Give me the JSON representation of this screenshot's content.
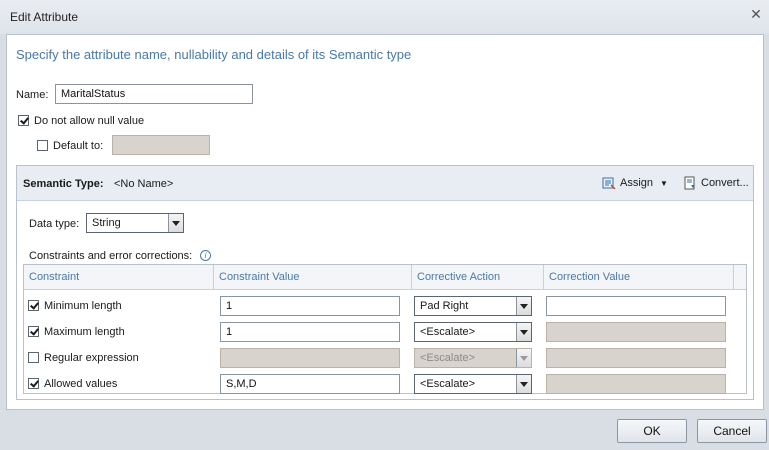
{
  "window": {
    "title": "Edit Attribute"
  },
  "heading": "Specify the attribute name, nullability and details of its Semantic type",
  "name": {
    "label": "Name:",
    "value": "MaritalStatus"
  },
  "null_option": {
    "label": "Do not allow null value",
    "checked": true
  },
  "default_option": {
    "label": "Default to:",
    "checked": false,
    "value": ""
  },
  "semantic": {
    "label": "Semantic Type:",
    "value": "<No Name>",
    "assign_label": "Assign",
    "convert_label": "Convert...",
    "data_type_label": "Data type:",
    "data_type_value": "String",
    "constraints_label": "Constraints and error corrections:"
  },
  "grid": {
    "headers": [
      "Constraint",
      "Constraint Value",
      "Corrective Action",
      "Correction Value"
    ],
    "rows": [
      {
        "checked": true,
        "constraint": "Minimum length",
        "value": "1",
        "action": "Pad Right",
        "action_enabled": true,
        "correction": "",
        "correction_enabled": true
      },
      {
        "checked": true,
        "constraint": "Maximum length",
        "value": "1",
        "action": "<Escalate>",
        "action_enabled": true,
        "correction": "",
        "correction_enabled": false
      },
      {
        "checked": false,
        "constraint": "Regular expression",
        "value": "",
        "action": "<Escalate>",
        "action_enabled": false,
        "correction": "",
        "correction_enabled": false
      },
      {
        "checked": true,
        "constraint": "Allowed values",
        "value": "S,M,D",
        "action": "<Escalate>",
        "action_enabled": true,
        "correction": "",
        "correction_enabled": false
      }
    ]
  },
  "buttons": {
    "ok": "OK",
    "cancel": "Cancel"
  }
}
